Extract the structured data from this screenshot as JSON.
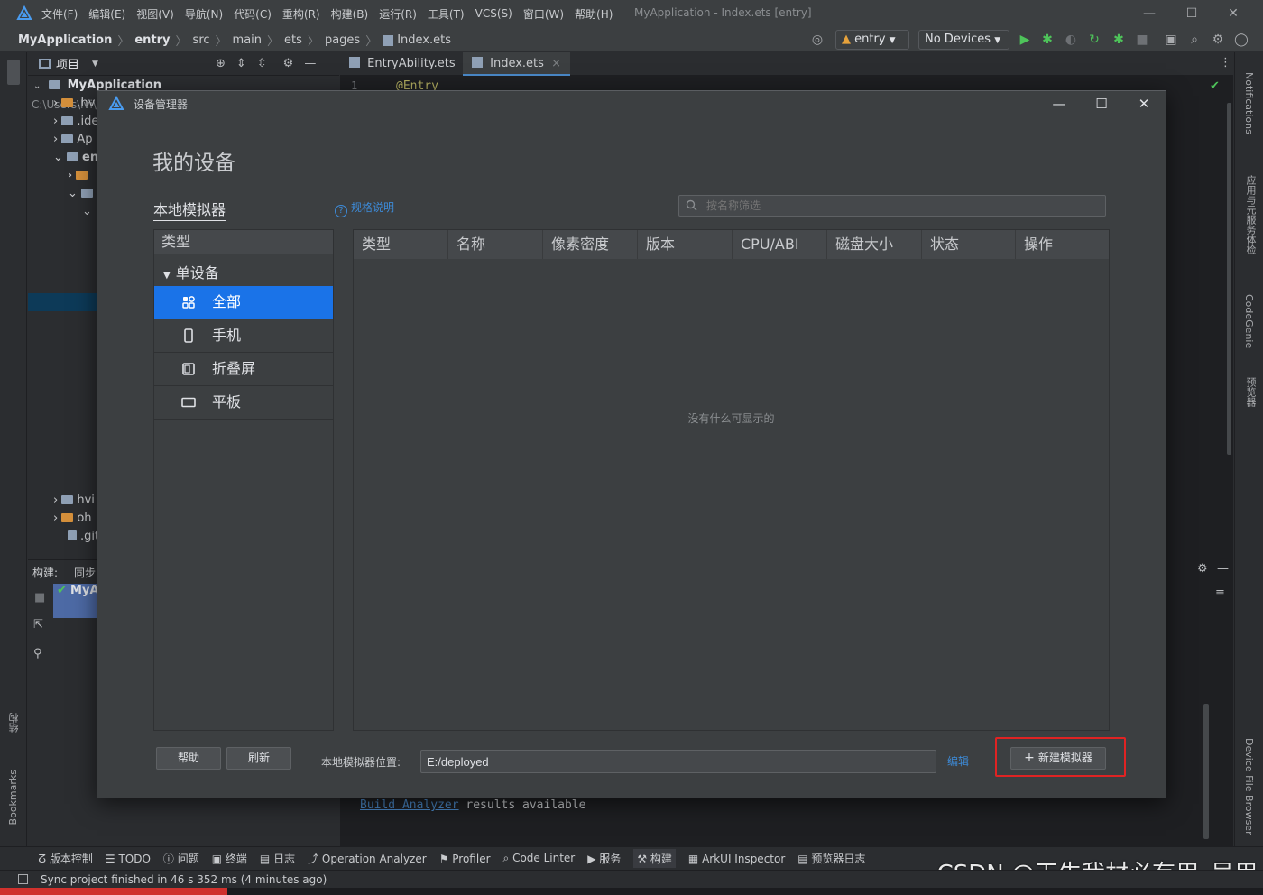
{
  "ide": {
    "menu": [
      "文件(F)",
      "编辑(E)",
      "视图(V)",
      "导航(N)",
      "代码(C)",
      "重构(R)",
      "构建(B)",
      "运行(R)",
      "工具(T)",
      "VCS(S)",
      "窗口(W)",
      "帮助(H)"
    ],
    "window_title": "MyApplication - Index.ets [entry]",
    "breadcrumbs": [
      "MyApplication",
      "entry",
      "src",
      "main",
      "ets",
      "pages",
      "Index.ets"
    ],
    "run_config": "entry",
    "device_select": "No Devices",
    "project_tab": "项目",
    "editor_tabs": [
      "EntryAbility.ets",
      "Index.ets"
    ],
    "tree": {
      "root_name": "MyApplication",
      "root_path": "C:\\Users\\lvi\\DevEcoStudioProjects\\",
      "items": [
        ".hv",
        ".idе",
        "Ap",
        "ent",
        "hvi",
        "oh",
        ".git"
      ]
    },
    "editor_line_no": "1",
    "editor_code": "@Entry",
    "build": {
      "label": "构建:",
      "sync_tab": "同步",
      "task": "MyA"
    },
    "console_link": "Build Analyzer",
    "console_text": " results available",
    "right_tools": [
      "Notifications",
      "应用与元服务体检",
      "CodeGenie",
      "预览器",
      "Device File Browser"
    ],
    "left_tools": [
      "结构",
      "Bookmarks"
    ],
    "bottom_tools": [
      "版本控制",
      "TODO",
      "问题",
      "终端",
      "日志",
      "Operation Analyzer",
      "Profiler",
      "Code Linter",
      "服务",
      "构建",
      "ArkUI Inspector",
      "预览器日志"
    ],
    "status": "Sync project finished in 46 s 352 ms (4 minutes ago)",
    "watermark": "CSDN @天生我材必有用_吴用"
  },
  "dialog": {
    "title": "设备管理器",
    "heading": "我的设备",
    "tab_local": "本地模拟器",
    "spec_link": "规格说明",
    "filter_placeholder": "按名称筛选",
    "type_panel": {
      "header": "类型",
      "group": "单设备",
      "items": [
        "全部",
        "手机",
        "折叠屏",
        "平板"
      ],
      "selected": "全部"
    },
    "table": {
      "columns": [
        "类型",
        "名称",
        "像素密度",
        "版本",
        "CPU/ABI",
        "磁盘大小",
        "状态",
        "操作"
      ],
      "empty_message": "没有什么可显示的"
    },
    "help_button": "帮助",
    "refresh_button": "刷新",
    "location_label": "本地模拟器位置:",
    "location_value": "E:/deployed",
    "edit_link": "编辑",
    "new_emulator_button": "新建模拟器"
  },
  "colors": {
    "accent": "#1a73e8",
    "link": "#3d8bd9",
    "highlight": "#e02323"
  }
}
